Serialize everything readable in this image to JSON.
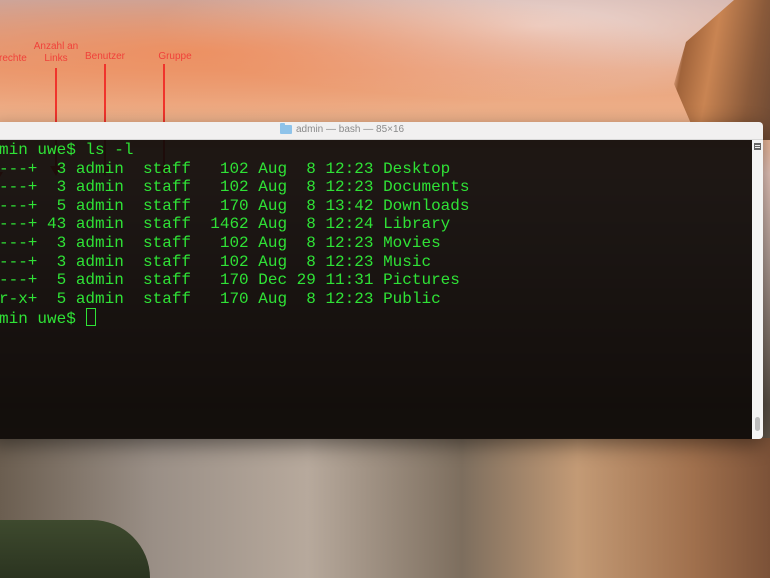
{
  "annotations": [
    {
      "label": "srechte"
    },
    {
      "label": "Anzahl an Links"
    },
    {
      "label": "Benutzer"
    },
    {
      "label": "Gruppe"
    }
  ],
  "window": {
    "title": "admin — bash — 85×16",
    "icon": "folder-icon"
  },
  "terminal": {
    "prompt_line": "min uwe$ ls -l",
    "rows": [
      "---+  3 admin  staff   102 Aug  8 12:23 Desktop",
      "---+  3 admin  staff   102 Aug  8 12:23 Documents",
      "---+  5 admin  staff   170 Aug  8 13:42 Downloads",
      "---+ 43 admin  staff  1462 Aug  8 12:24 Library",
      "---+  3 admin  staff   102 Aug  8 12:23 Movies",
      "---+  3 admin  staff   102 Aug  8 12:23 Music",
      "---+  5 admin  staff   170 Dec 29 11:31 Pictures",
      "r-x+  5 admin  staff   170 Aug  8 12:23 Public"
    ],
    "final_prompt": "min uwe$ ",
    "text_color": "#2fe236"
  },
  "colors": {
    "annotation": "#f0413a"
  }
}
